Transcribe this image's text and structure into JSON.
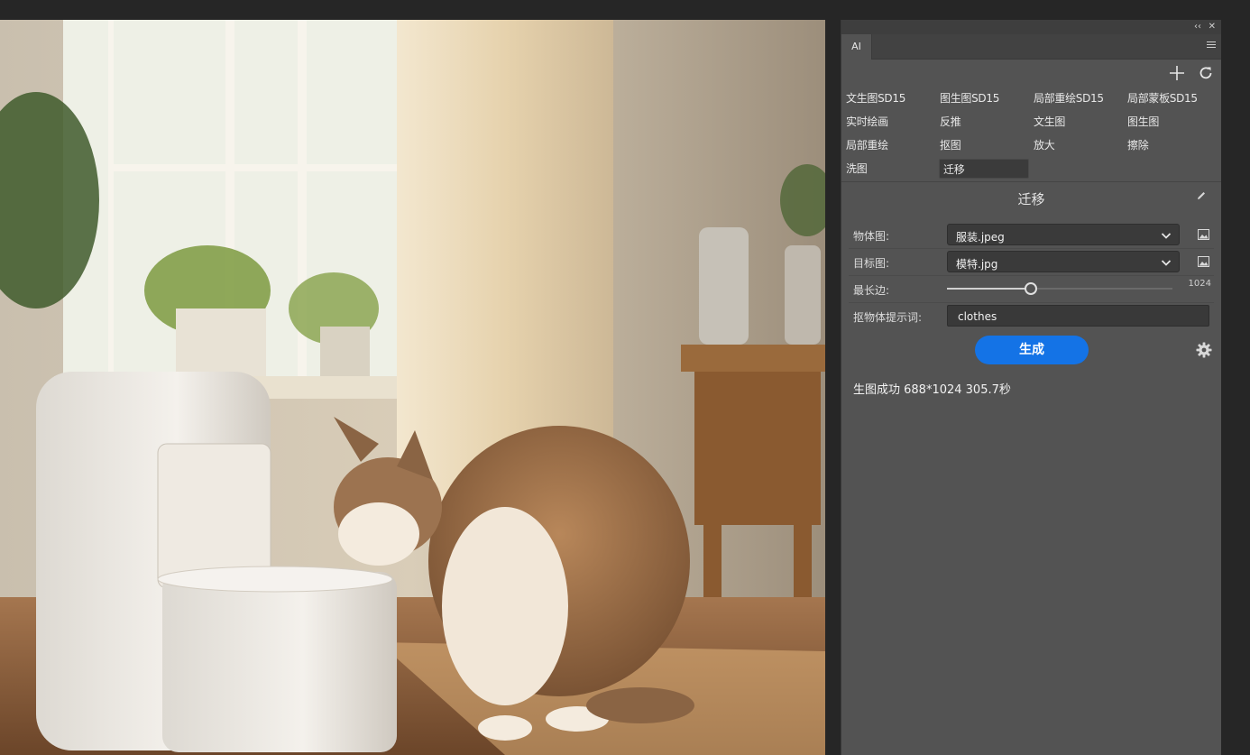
{
  "panel": {
    "collapse_glyph": "‹‹",
    "close_glyph": "✕",
    "tab_label": "AI",
    "toolbar_icons": [
      "plus-icon",
      "refresh-icon"
    ]
  },
  "functions": [
    {
      "label": "文生图SD15"
    },
    {
      "label": "图生图SD15"
    },
    {
      "label": "局部重绘SD15"
    },
    {
      "label": "局部蒙板SD15"
    },
    {
      "label": "实时绘画"
    },
    {
      "label": "反推"
    },
    {
      "label": "文生图"
    },
    {
      "label": "图生图"
    },
    {
      "label": "局部重绘"
    },
    {
      "label": "抠图"
    },
    {
      "label": "放大"
    },
    {
      "label": "擦除"
    },
    {
      "label": "洗图"
    },
    {
      "label": "迁移",
      "active": true
    }
  ],
  "section": {
    "title": "迁移"
  },
  "form": {
    "object_image_label": "物体图:",
    "object_image_value": "服装.jpeg",
    "target_image_label": "目标图:",
    "target_image_value": "模特.jpg",
    "max_side_label": "最长边:",
    "max_side_value": "1024",
    "max_side_fraction": 0.37,
    "prompt_label": "抠物体提示词:",
    "prompt_value": "clothes"
  },
  "actions": {
    "generate_label": "生成"
  },
  "status": {
    "text": "生图成功 688*1024 305.7秒"
  },
  "colors": {
    "accent": "#1473e6",
    "panel_bg": "#535353",
    "app_bg": "#262626"
  }
}
